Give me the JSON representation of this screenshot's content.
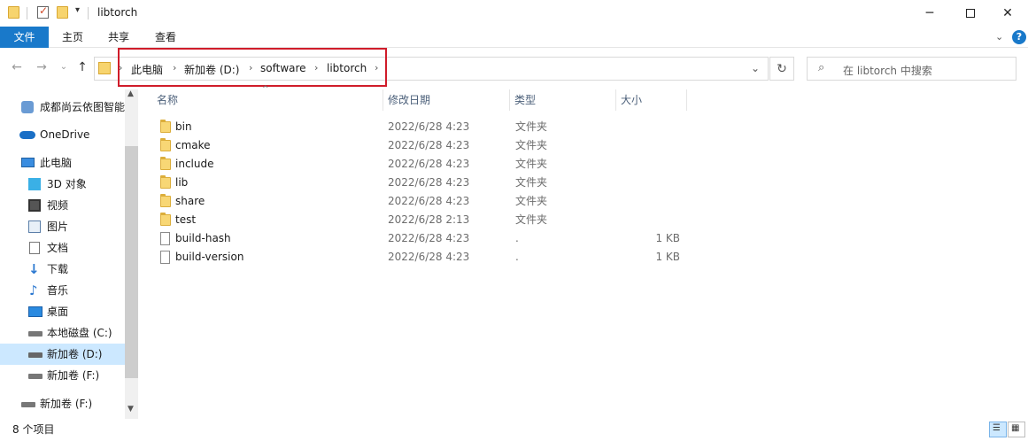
{
  "window": {
    "title": "libtorch",
    "minimize_icon": "minimize-icon",
    "maximize_icon": "maximize-icon",
    "close_icon": "close-icon"
  },
  "ribbon": {
    "tabs": [
      {
        "label": "文件"
      },
      {
        "label": "主页"
      },
      {
        "label": "共享"
      },
      {
        "label": "查看"
      }
    ]
  },
  "address": {
    "crumbs": [
      "此电脑",
      "新加卷 (D:)",
      "software",
      "libtorch"
    ],
    "search_placeholder": "在 libtorch 中搜索"
  },
  "sidebar": {
    "items": [
      {
        "label": "成都尚云依图智能",
        "icon": "cloud-user-icon"
      },
      {
        "label": "OneDrive",
        "icon": "onedrive-icon"
      },
      {
        "label": "此电脑",
        "icon": "pc-icon"
      },
      {
        "label": "3D 对象",
        "icon": "cube-icon"
      },
      {
        "label": "视频",
        "icon": "video-icon"
      },
      {
        "label": "图片",
        "icon": "picture-icon"
      },
      {
        "label": "文档",
        "icon": "document-icon"
      },
      {
        "label": "下载",
        "icon": "download-icon"
      },
      {
        "label": "音乐",
        "icon": "music-icon"
      },
      {
        "label": "桌面",
        "icon": "desktop-icon"
      },
      {
        "label": "本地磁盘 (C:)",
        "icon": "drive-icon"
      },
      {
        "label": "新加卷 (D:)",
        "icon": "drive-icon"
      },
      {
        "label": "新加卷 (F:)",
        "icon": "drive-icon"
      },
      {
        "label": "新加卷 (F:)",
        "icon": "drive-icon"
      }
    ]
  },
  "columns": {
    "name": "名称",
    "modified": "修改日期",
    "type": "类型",
    "size": "大小"
  },
  "files": [
    {
      "name": "bin",
      "modified": "2022/6/28 4:23",
      "type": "文件夹",
      "size": "",
      "kind": "folder"
    },
    {
      "name": "cmake",
      "modified": "2022/6/28 4:23",
      "type": "文件夹",
      "size": "",
      "kind": "folder"
    },
    {
      "name": "include",
      "modified": "2022/6/28 4:23",
      "type": "文件夹",
      "size": "",
      "kind": "folder"
    },
    {
      "name": "lib",
      "modified": "2022/6/28 4:23",
      "type": "文件夹",
      "size": "",
      "kind": "folder"
    },
    {
      "name": "share",
      "modified": "2022/6/28 4:23",
      "type": "文件夹",
      "size": "",
      "kind": "folder"
    },
    {
      "name": "test",
      "modified": "2022/6/28 2:13",
      "type": "文件夹",
      "size": "",
      "kind": "folder"
    },
    {
      "name": "build-hash",
      "modified": "2022/6/28 4:23",
      "type": ".",
      "size": "1 KB",
      "kind": "file"
    },
    {
      "name": "build-version",
      "modified": "2022/6/28 4:23",
      "type": ".",
      "size": "1 KB",
      "kind": "file"
    }
  ],
  "status": {
    "item_count": "8 个项目"
  },
  "colors": {
    "accent": "#1979ca",
    "selection": "#cce8ff",
    "highlight_box": "#d01c2a"
  }
}
